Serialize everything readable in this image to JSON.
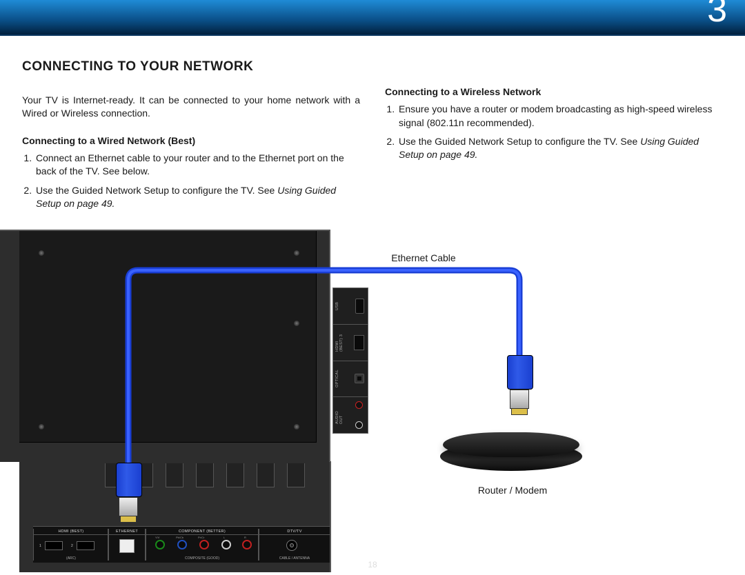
{
  "chapter_number": "3",
  "page_number": "18",
  "title": "CONNECTING TO YOUR NETWORK",
  "intro": "Your TV is Internet-ready. It can be connected to your home network with a Wired or Wireless connection.",
  "wired": {
    "heading": "Connecting to a Wired Network (Best)",
    "steps": [
      "Connect an Ethernet cable to your router and to the Ethernet port on the back of the TV. See below.",
      "Use the Guided Network Setup to configure the TV. See "
    ],
    "ref": "Using Guided Setup on page 49."
  },
  "wireless": {
    "heading": "Connecting to a Wireless Network",
    "steps": [
      "Ensure you have a router or modem broadcasting as high-speed wireless signal (802.11n recommended).",
      "Use the Guided Network Setup to configure the TV. See "
    ],
    "ref": "Using Guided Setup on page 49."
  },
  "labels": {
    "ethernet_cable": "Ethernet Cable",
    "router_modem": "Router / Modem"
  },
  "ports": {
    "side": {
      "usb": "USB",
      "hdmi3": "HDMI (BEST) 3",
      "optical": "OPTICAL",
      "audio_out": "AUDIO OUT"
    },
    "bottom": {
      "hdmi": "HDMI (BEST)",
      "hdmi_sub": "(ARC)",
      "hdmi_1": "1",
      "hdmi_2": "2",
      "ethernet": "ETHERNET",
      "component": "COMPONENT (BETTER)",
      "component_sub": "COMPOSITE (GOOD)",
      "comp_y": "Y/V",
      "comp_pb": "Pb/Cb",
      "comp_pr": "Pr/Cr",
      "comp_l": "L",
      "comp_r": "R",
      "dtv": "DTV/TV",
      "dtv_sub": "CABLE / ANTENNA"
    }
  }
}
